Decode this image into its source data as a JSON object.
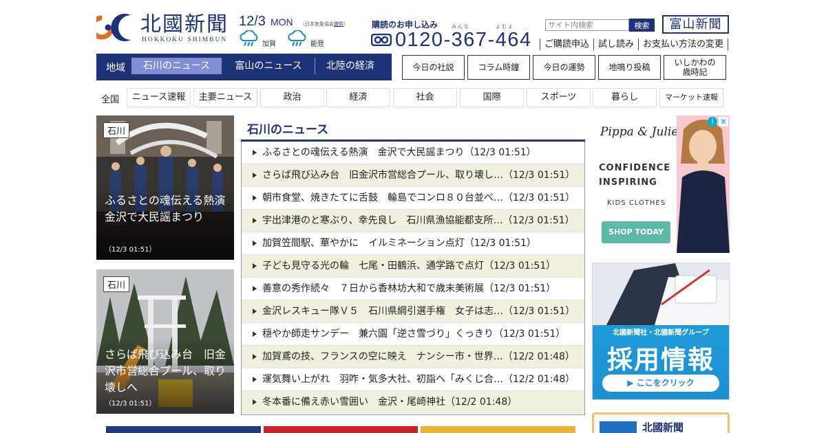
{
  "header": {
    "logo_name": "北國新聞",
    "logo_roman": "HOKKOKU SHIMBUN",
    "date": "12/3",
    "weekday": "MON",
    "weather_note_prefix": "（日本気象協会",
    "weather_note_link": "提供",
    "weather_note_suffix": "）",
    "weather": [
      {
        "icon": "rain-cloud-icon",
        "label": "加賀"
      },
      {
        "icon": "rain-cloud-icon",
        "label": "能登"
      }
    ],
    "subscribe_label": "購読のお申し込み",
    "phone_kana_1": "みんな",
    "phone_kana_2": "よむよ",
    "phone_number": "0120-367-464",
    "search_placeholder": "サイト内検索",
    "search_button": "検索",
    "toyama_logo": "富山新聞",
    "util_links": [
      "ご購読申込",
      "試し読み",
      "お支払い方法の変更"
    ]
  },
  "region_nav": {
    "label": "地域",
    "tabs": [
      {
        "label": "石川のニュース",
        "active": true
      },
      {
        "label": "富山のニュース",
        "active": false
      },
      {
        "label": "北陸の経済",
        "active": false
      }
    ]
  },
  "feature_buttons": [
    "今日の社説",
    "コラム時鐘",
    "今日の運勢",
    "地鳴り投稿",
    "いしかわの\n歳時記"
  ],
  "category_nav": {
    "all": "全国",
    "items": [
      "ニュース速報",
      "主要ニュース",
      "政治",
      "経済",
      "社会",
      "国際",
      "スポーツ",
      "暮らし",
      "マーケット速報"
    ]
  },
  "photo_cards": [
    {
      "tag": "石川",
      "caption": "ふるさとの魂伝える熱演　金沢で大民謡まつり",
      "time": "（12/3 01:51）"
    },
    {
      "tag": "石川",
      "caption": "さらば飛び込み台　旧金沢市営総合プール、取り壊しへ",
      "time": "（12/3 01:51）"
    }
  ],
  "news": {
    "title": "石川のニュース",
    "items": [
      "ふるさとの魂伝える熱演　金沢で大民謡まつり（12/3 01:51）",
      "さらば飛び込み台　旧金沢市営総合プール、取り壊し…（12/3 01:51）",
      "朝市食堂、焼きたてに舌鼓　輪島でコンロ８０台並べ…（12/3 01:51）",
      "宇出津港のと寒ぶり、幸先良し　石川県漁協能都支所…（12/3 01:51）",
      "加賀笠間駅、華やかに　イルミネーション点灯（12/3 01:51）",
      "子ども見守る光の輪　七尾・田鶴浜、通学路で点灯（12/3 01:51）",
      "善意の秀作続々　７日から香林坊大和で歳末美術展（12/3 01:51）",
      "金沢レスキュー隊Ｖ５　石川県綱引選手権　女子は志…（12/3 01:51）",
      "穏やか師走サンデー　兼六園「逆さ雪づり」くっきり（12/3 01:51）",
      "加賀鳶の技、フランスの空に映え　ナンシー市・世界…（12/2 01:48）",
      "運気舞い上がれ　羽咋・気多大社、初詣へ「みくじ合…（12/2 01:48）",
      "冬本番に備え赤い雪囲い　金沢・尾崎神社（12/2 01:48）"
    ]
  },
  "ads": {
    "kids": {
      "brand": "Pippa & Julie",
      "headline_1": "CONFIDENCE",
      "headline_2": "INSPIRING",
      "sub": "KIDS CLOTHES",
      "button": "SHOP TODAY",
      "ad_icon": "i",
      "close": "✕"
    },
    "recruit": {
      "top_text": "北國新聞社・北國新聞グループ",
      "big": "採用情報",
      "cta": "▶ ここをクリック"
    },
    "paper": {
      "text": "北國新聞"
    }
  },
  "colors": {
    "brand_navy": "#1e3278",
    "active_tab": "#7f8fd4",
    "alt_row": "#f1f0de"
  }
}
